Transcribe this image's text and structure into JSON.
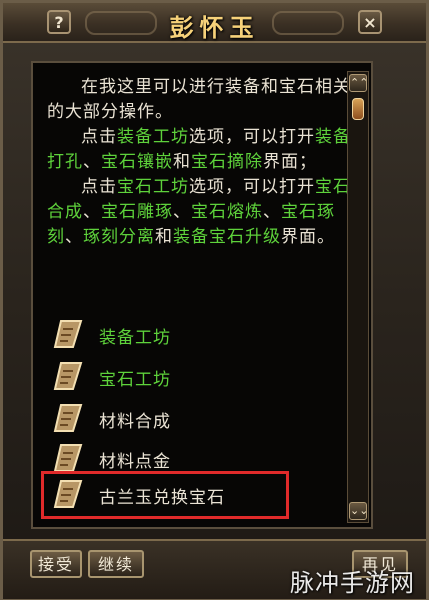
{
  "window": {
    "title": "彭怀玉",
    "help": "?",
    "close": "×"
  },
  "description": {
    "p1": "在我这里可以进行装备和宝石相关的大部分操作。",
    "p2": [
      {
        "t": "点击",
        "g": false
      },
      {
        "t": "装备工坊",
        "g": true
      },
      {
        "t": "选项，可以打开",
        "g": false
      },
      {
        "t": "装备打孔",
        "g": true
      },
      {
        "t": "、",
        "g": false
      },
      {
        "t": "宝石镶嵌",
        "g": true
      },
      {
        "t": "和",
        "g": false
      },
      {
        "t": "宝石摘除",
        "g": true
      },
      {
        "t": "界面；",
        "g": false
      }
    ],
    "p3": [
      {
        "t": "点击",
        "g": false
      },
      {
        "t": "宝石工坊",
        "g": true
      },
      {
        "t": "选项，可以打开",
        "g": false
      },
      {
        "t": "宝石合成",
        "g": true
      },
      {
        "t": "、",
        "g": false
      },
      {
        "t": "宝石雕琢",
        "g": true
      },
      {
        "t": "、",
        "g": false
      },
      {
        "t": "宝石熔炼",
        "g": true
      },
      {
        "t": "、",
        "g": false
      },
      {
        "t": "宝石琢刻",
        "g": true
      },
      {
        "t": "、",
        "g": false
      },
      {
        "t": "琢刻分离",
        "g": true
      },
      {
        "t": "和",
        "g": false
      },
      {
        "t": "装备宝石升级",
        "g": true
      },
      {
        "t": "界面。",
        "g": false
      }
    ]
  },
  "options": [
    {
      "label": "装备工坊",
      "color": "#5ed23b"
    },
    {
      "label": "宝石工坊",
      "color": "#5ed23b"
    },
    {
      "label": "材料合成",
      "color": "#eae3d4"
    },
    {
      "label": "材料点金",
      "color": "#eae3d4"
    },
    {
      "label": "古兰玉兑换宝石",
      "color": "#eae3d4"
    }
  ],
  "scroll": {
    "up": "⌃⌃",
    "down": "⌄⌄"
  },
  "buttons": {
    "accept": "接受",
    "continue": "继续",
    "next": "再见"
  },
  "watermark": "脉冲手游网"
}
